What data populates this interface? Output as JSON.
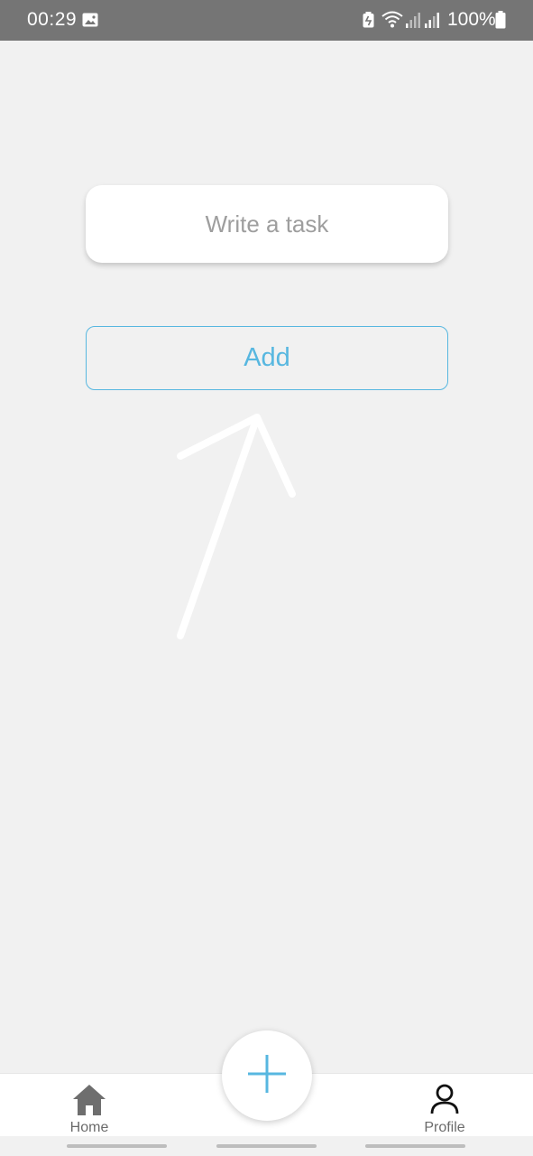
{
  "status_bar": {
    "time": "00:29",
    "battery_percent": "100%",
    "icons": [
      "gallery-icon",
      "battery-saver-icon",
      "wifi-icon",
      "signal-icon",
      "signal-icon",
      "battery-icon"
    ]
  },
  "task_form": {
    "input_value": "",
    "input_placeholder": "Write a task",
    "add_label": "Add"
  },
  "bottom_nav": {
    "home_label": "Home",
    "profile_label": "Profile",
    "fab_icon": "plus-icon"
  },
  "colors": {
    "accent": "#57b7e0",
    "status_bar_bg": "#757575",
    "background": "#f1f1f1"
  }
}
